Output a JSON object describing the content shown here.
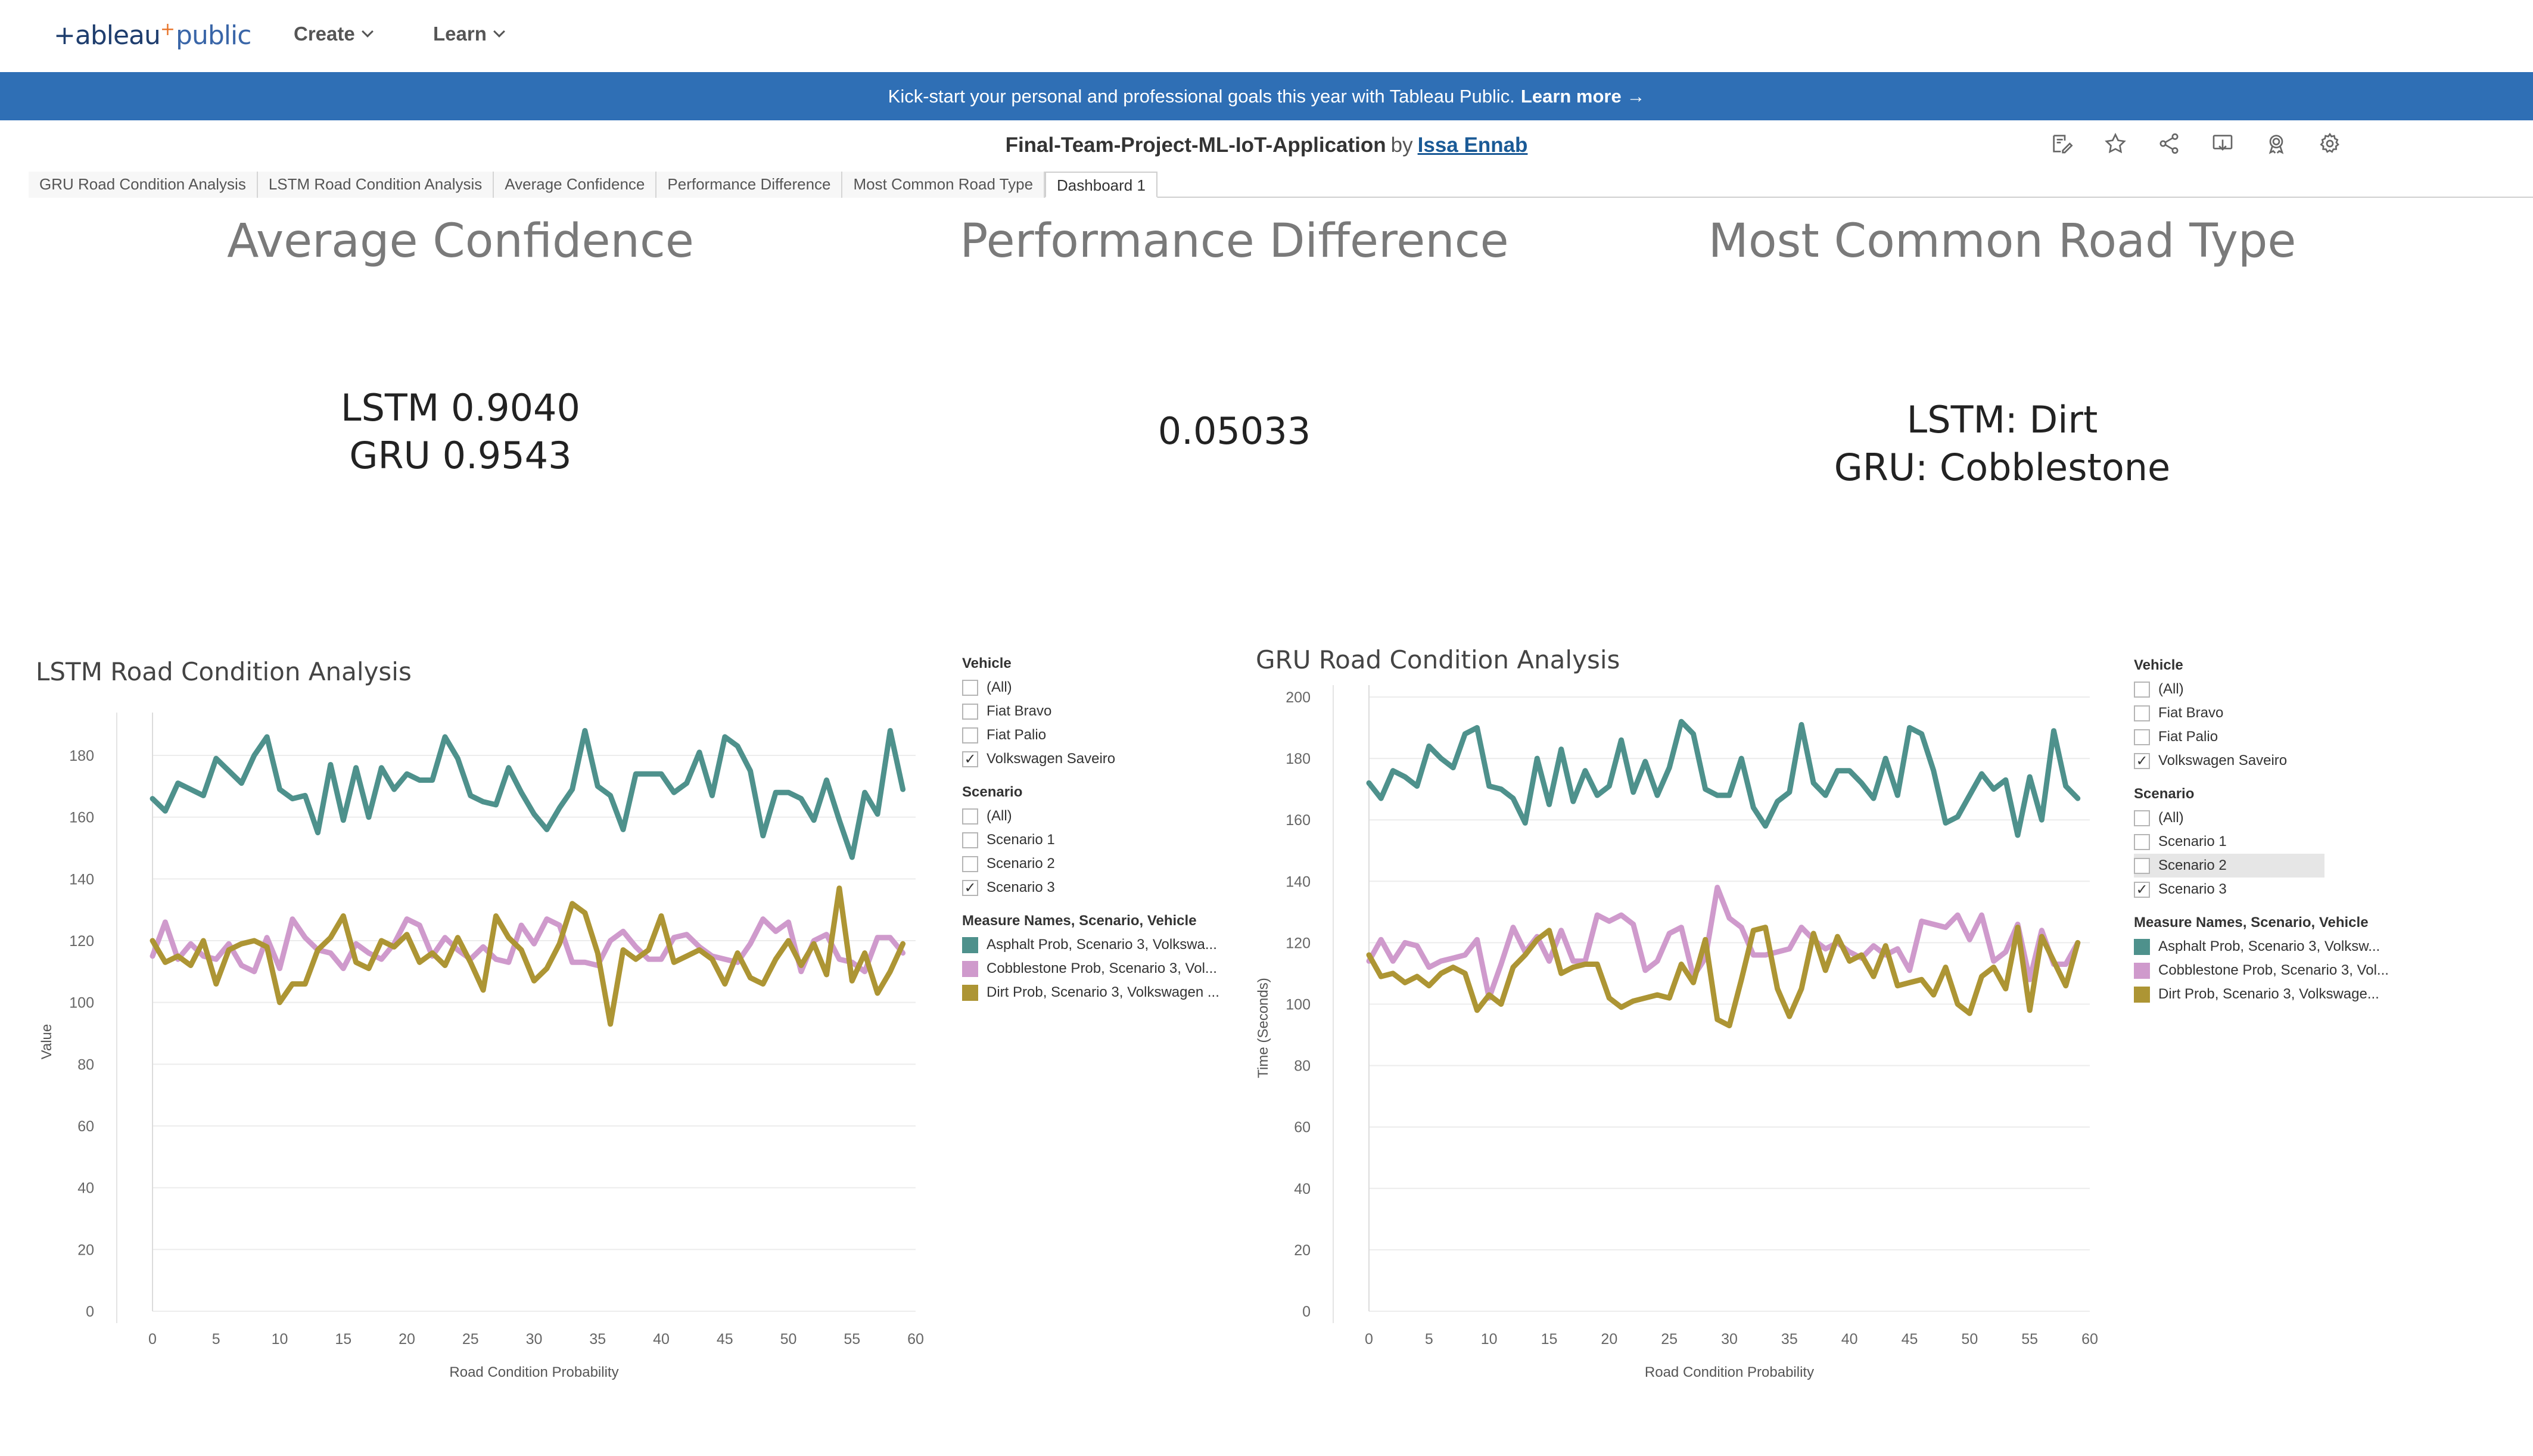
{
  "nav": {
    "logo_part1": "+ableau",
    "logo_plus": "+",
    "logo_part2": "public",
    "create": "Create",
    "learn": "Learn"
  },
  "banner": {
    "text": "Kick-start your personal and professional goals this year with Tableau Public.",
    "link": "Learn more →"
  },
  "workbook": {
    "name": "Final-Team-Project-ML-IoT-Application",
    "by": "by",
    "author": "Issa Ennab"
  },
  "toolbar_icons": [
    "edit-icon",
    "star-icon",
    "share-icon",
    "download-icon",
    "badge-icon",
    "settings-icon"
  ],
  "tabs": [
    {
      "label": "GRU Road Condition Analysis"
    },
    {
      "label": "LSTM Road Condition Analysis"
    },
    {
      "label": "Average Confidence"
    },
    {
      "label": "Performance Difference"
    },
    {
      "label": "Most Common Road Type"
    },
    {
      "label": "Dashboard 1"
    }
  ],
  "kpis": {
    "avg_conf": {
      "title": "Average Confidence",
      "line1": "LSTM 0.9040",
      "line2": "GRU 0.9543"
    },
    "perf_diff": {
      "title": "Performance Difference",
      "value": "0.05033"
    },
    "road_type": {
      "title": "Most Common Road Type",
      "line1": "LSTM: Dirt",
      "line2": "GRU: Cobblestone"
    }
  },
  "colors": {
    "asphalt": "#4e918c",
    "cobblestone": "#cf9acc",
    "dirt": "#ad9534",
    "brand_blue": "#2f6fb5"
  },
  "filters": {
    "lstm": {
      "vehicle_header": "Vehicle",
      "vehicles": [
        {
          "label": "(All)",
          "checked": false
        },
        {
          "label": "Fiat Bravo",
          "checked": false
        },
        {
          "label": "Fiat Palio",
          "checked": false
        },
        {
          "label": "Volkswagen Saveiro",
          "checked": true
        }
      ],
      "scenario_header": "Scenario",
      "scenarios": [
        {
          "label": "(All)",
          "checked": false
        },
        {
          "label": "Scenario 1",
          "checked": false
        },
        {
          "label": "Scenario 2",
          "checked": false
        },
        {
          "label": "Scenario 3",
          "checked": true
        }
      ],
      "legend_header": "Measure Names, Scenario, Vehicle",
      "legend": [
        {
          "label": "Asphalt Prob, Scenario 3, Volkswa...",
          "color": "#4e918c"
        },
        {
          "label": "Cobblestone Prob, Scenario 3, Vol...",
          "color": "#cf9acc"
        },
        {
          "label": "Dirt Prob, Scenario 3, Volkswagen ...",
          "color": "#ad9534"
        }
      ]
    },
    "gru": {
      "vehicle_header": "Vehicle",
      "vehicles": [
        {
          "label": "(All)",
          "checked": false
        },
        {
          "label": "Fiat Bravo",
          "checked": false
        },
        {
          "label": "Fiat Palio",
          "checked": false
        },
        {
          "label": "Volkswagen Saveiro",
          "checked": true
        }
      ],
      "scenario_header": "Scenario",
      "scenarios": [
        {
          "label": "(All)",
          "checked": false
        },
        {
          "label": "Scenario 1",
          "checked": false
        },
        {
          "label": "Scenario 2",
          "checked": false
        },
        {
          "label": "Scenario 3",
          "checked": true
        }
      ],
      "legend_header": "Measure Names, Scenario, Vehicle",
      "legend": [
        {
          "label": "Asphalt Prob, Scenario 3, Volksw...",
          "color": "#4e918c"
        },
        {
          "label": "Cobblestone Prob, Scenario 3, Vol...",
          "color": "#cf9acc"
        },
        {
          "label": "Dirt Prob, Scenario 3, Volkswage...",
          "color": "#ad9534"
        }
      ]
    }
  },
  "chart_data": [
    {
      "id": "lstm",
      "type": "line",
      "title": "LSTM Road Condition Analysis",
      "xlabel": "Road Condition Probability",
      "ylabel": "Value",
      "xlim": [
        0,
        60
      ],
      "ylim": [
        0,
        190
      ],
      "xticks": [
        0,
        5,
        10,
        15,
        20,
        25,
        30,
        35,
        40,
        45,
        50,
        55,
        60
      ],
      "yticks": [
        0,
        20,
        40,
        60,
        80,
        100,
        120,
        140,
        160,
        180
      ],
      "grid": true,
      "x": [
        0,
        1,
        2,
        3,
        4,
        5,
        6,
        7,
        8,
        9,
        10,
        11,
        12,
        13,
        14,
        15,
        16,
        17,
        18,
        19,
        20,
        21,
        22,
        23,
        24,
        25,
        26,
        27,
        28,
        29,
        30,
        31,
        32,
        33,
        34,
        35,
        36,
        37,
        38,
        39,
        40,
        41,
        42,
        43,
        44,
        45,
        46,
        47,
        48,
        49,
        50,
        51,
        52,
        53,
        54,
        55,
        56,
        57,
        58,
        59
      ],
      "series": [
        {
          "name": "Asphalt Prob, Scenario 3, Volkswa...",
          "color": "#4e918c",
          "values": [
            166,
            162,
            171,
            169,
            167,
            179,
            175,
            171,
            180,
            186,
            169,
            166,
            167,
            155,
            177,
            159,
            176,
            160,
            176,
            169,
            174,
            172,
            172,
            186,
            179,
            167,
            165,
            164,
            176,
            168,
            161,
            156,
            163,
            169,
            188,
            170,
            167,
            156,
            174,
            174,
            174,
            168,
            171,
            181,
            167,
            186,
            183,
            175,
            154,
            168,
            168,
            166,
            159,
            172,
            159,
            147,
            168,
            161,
            188,
            169
          ]
        },
        {
          "name": "Cobblestone Prob, Scenario 3, Vol...",
          "color": "#cf9acc",
          "values": [
            115,
            126,
            114,
            119,
            115,
            114,
            119,
            112,
            110,
            121,
            111,
            127,
            121,
            117,
            116,
            111,
            119,
            116,
            114,
            119,
            127,
            125,
            115,
            121,
            117,
            114,
            118,
            114,
            113,
            125,
            119,
            127,
            125,
            113,
            113,
            112,
            120,
            123,
            118,
            114,
            114,
            121,
            122,
            118,
            115,
            114,
            113,
            119,
            127,
            123,
            126,
            110,
            120,
            122,
            114,
            113,
            110,
            121,
            121,
            116
          ]
        },
        {
          "name": "Dirt Prob, Scenario 3, Volkswagen ...",
          "color": "#ad9534",
          "values": [
            120,
            113,
            115,
            112,
            120,
            106,
            117,
            119,
            120,
            118,
            100,
            106,
            106,
            117,
            121,
            128,
            113,
            111,
            120,
            118,
            122,
            113,
            116,
            112,
            121,
            113,
            104,
            128,
            121,
            117,
            107,
            111,
            119,
            132,
            129,
            116,
            93,
            117,
            114,
            117,
            128,
            113,
            115,
            117,
            114,
            106,
            116,
            108,
            106,
            114,
            120,
            112,
            119,
            109,
            137,
            107,
            116,
            103,
            110,
            119
          ]
        }
      ]
    },
    {
      "id": "gru",
      "type": "line",
      "title": "GRU Road Condition Analysis",
      "xlabel": "Road Condition Probability",
      "ylabel": "Time (Seconds)",
      "xlim": [
        0,
        60
      ],
      "ylim": [
        0,
        200
      ],
      "xticks": [
        0,
        5,
        10,
        15,
        20,
        25,
        30,
        35,
        40,
        45,
        50,
        55,
        60
      ],
      "yticks": [
        0,
        20,
        40,
        60,
        80,
        100,
        120,
        140,
        160,
        180,
        200
      ],
      "grid": true,
      "x": [
        0,
        1,
        2,
        3,
        4,
        5,
        6,
        7,
        8,
        9,
        10,
        11,
        12,
        13,
        14,
        15,
        16,
        17,
        18,
        19,
        20,
        21,
        22,
        23,
        24,
        25,
        26,
        27,
        28,
        29,
        30,
        31,
        32,
        33,
        34,
        35,
        36,
        37,
        38,
        39,
        40,
        41,
        42,
        43,
        44,
        45,
        46,
        47,
        48,
        49,
        50,
        51,
        52,
        53,
        54,
        55,
        56,
        57,
        58,
        59
      ],
      "series": [
        {
          "name": "Asphalt Prob, Scenario 3, Volksw...",
          "color": "#4e918c",
          "values": [
            172,
            167,
            176,
            174,
            171,
            184,
            180,
            177,
            188,
            190,
            171,
            170,
            167,
            159,
            180,
            165,
            183,
            166,
            176,
            168,
            171,
            186,
            169,
            179,
            168,
            177,
            192,
            188,
            170,
            168,
            168,
            180,
            164,
            158,
            166,
            169,
            191,
            172,
            168,
            176,
            176,
            172,
            167,
            180,
            168,
            190,
            188,
            176,
            159,
            161,
            168,
            175,
            170,
            173,
            155,
            174,
            160,
            189,
            171,
            167
          ]
        },
        {
          "name": "Cobblestone Prob, Scenario 3, Vol...",
          "color": "#cf9acc",
          "values": [
            114,
            121,
            114,
            120,
            119,
            112,
            114,
            115,
            116,
            121,
            102,
            113,
            125,
            117,
            122,
            114,
            124,
            114,
            114,
            129,
            127,
            129,
            126,
            111,
            114,
            123,
            125,
            109,
            115,
            138,
            128,
            125,
            116,
            116,
            117,
            118,
            125,
            121,
            118,
            120,
            117,
            115,
            119,
            116,
            118,
            111,
            127,
            126,
            125,
            129,
            121,
            129,
            114,
            117,
            126,
            108,
            124,
            113,
            113,
            120
          ]
        },
        {
          "name": "Dirt Prob, Scenario 3, Volkswagen ...",
          "color": "#ad9534",
          "values": [
            116,
            109,
            110,
            107,
            109,
            106,
            110,
            112,
            110,
            98,
            103,
            100,
            112,
            116,
            121,
            124,
            110,
            112,
            113,
            113,
            102,
            99,
            101,
            102,
            103,
            102,
            113,
            107,
            121,
            95,
            93,
            108,
            124,
            125,
            105,
            96,
            105,
            123,
            111,
            122,
            114,
            116,
            109,
            119,
            106,
            107,
            108,
            103,
            112,
            100,
            97,
            109,
            112,
            105,
            125,
            98,
            122,
            114,
            106,
            120
          ]
        }
      ]
    }
  ]
}
